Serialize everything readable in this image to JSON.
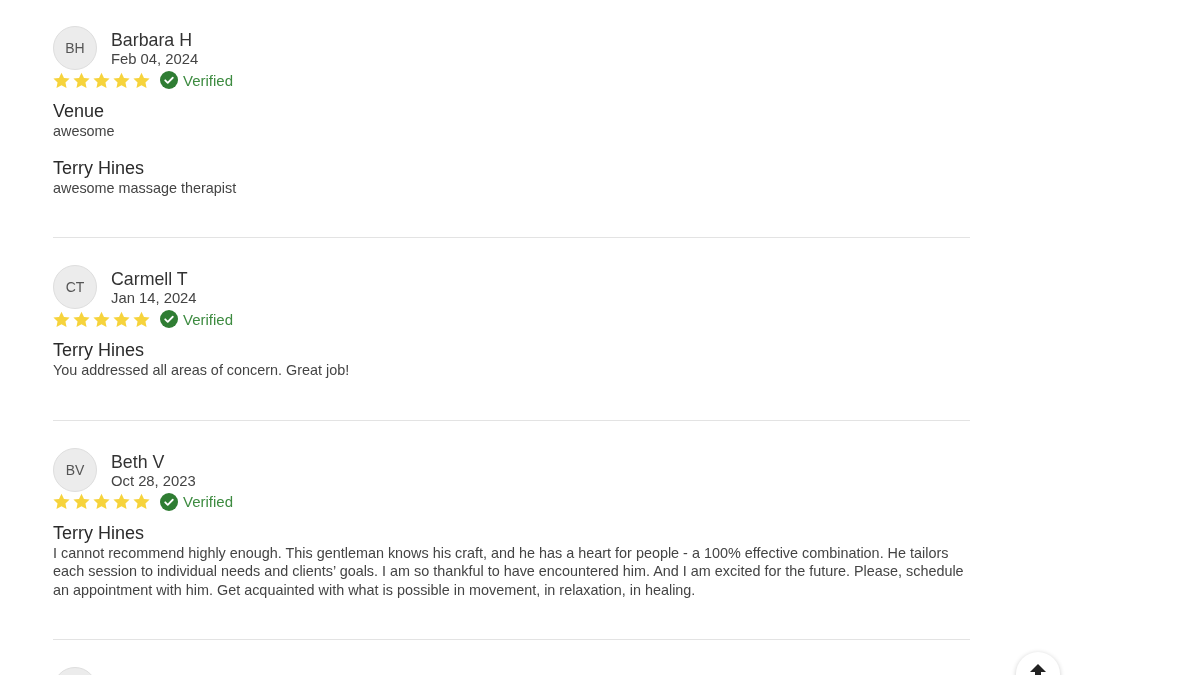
{
  "reviews": [
    {
      "initials": "BH",
      "name": "Barbara H",
      "date": "Feb 04, 2024",
      "stars": 5,
      "verified": true,
      "verified_label": "Verified",
      "sections": [
        {
          "title": "Venue",
          "text": "awesome"
        },
        {
          "title": "Terry Hines",
          "text": "awesome massage therapist"
        }
      ]
    },
    {
      "initials": "CT",
      "name": "Carmell T",
      "date": "Jan 14, 2024",
      "stars": 5,
      "verified": true,
      "verified_label": "Verified",
      "sections": [
        {
          "title": "Terry Hines",
          "text": "You addressed all areas of concern. Great job!"
        }
      ]
    },
    {
      "initials": "BV",
      "name": "Beth V",
      "date": "Oct 28, 2023",
      "stars": 5,
      "verified": true,
      "verified_label": "Verified",
      "sections": [
        {
          "title": "Terry Hines",
          "text": "I cannot recommend highly enough. This gentleman knows his craft, and he has a heart for people - a 100% effective combination. He tailors each session to individual needs and clients’ goals. I am so thankful to have encountered him. And I am excited for the future. Please, schedule an appointment with him. Get acquainted with what is possible in movement, in relaxation, in healing."
        }
      ]
    }
  ]
}
